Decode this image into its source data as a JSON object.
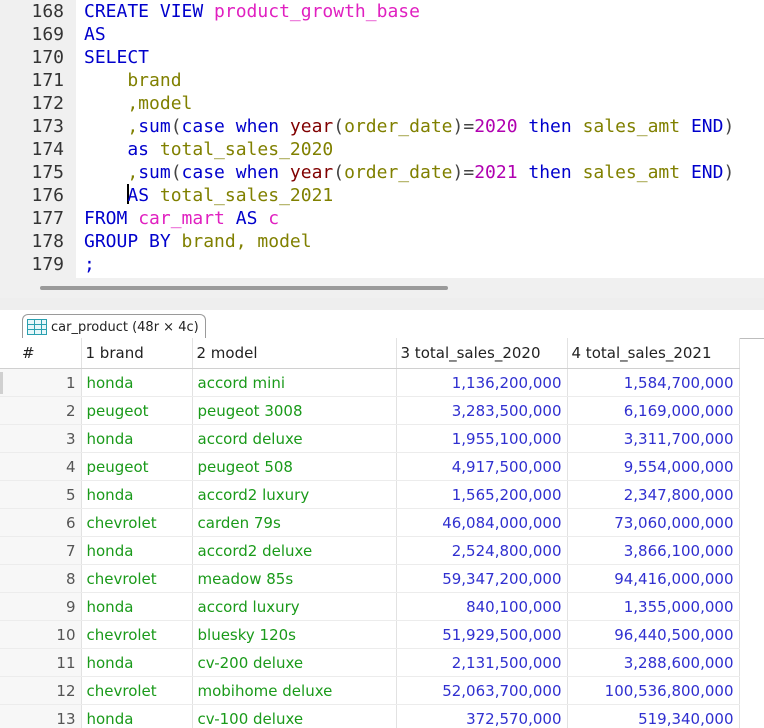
{
  "editor": {
    "lines": [
      {
        "n": "168",
        "tokens": [
          [
            "kw",
            "CREATE VIEW "
          ],
          [
            "id",
            "product_growth_base"
          ]
        ]
      },
      {
        "n": "169",
        "tokens": [
          [
            "kw",
            "AS"
          ]
        ]
      },
      {
        "n": "170",
        "tokens": [
          [
            "kw",
            "SELECT"
          ]
        ]
      },
      {
        "n": "171",
        "tokens": [
          [
            "col",
            "    brand"
          ]
        ]
      },
      {
        "n": "172",
        "tokens": [
          [
            "col",
            "    ,model"
          ]
        ]
      },
      {
        "n": "173",
        "tokens": [
          [
            "col",
            "    ,"
          ],
          [
            "kw",
            "sum"
          ],
          [
            "op",
            "("
          ],
          [
            "kw",
            "case when "
          ],
          [
            "fn",
            "year"
          ],
          [
            "op",
            "("
          ],
          [
            "col",
            "order_date"
          ],
          [
            "op",
            ")="
          ],
          [
            "num",
            "2020"
          ],
          [
            "kw",
            " then "
          ],
          [
            "col",
            "sales_amt "
          ],
          [
            "kw",
            "END"
          ],
          [
            "op",
            ")"
          ]
        ]
      },
      {
        "n": "174",
        "tokens": [
          [
            "kw",
            "    as "
          ],
          [
            "col",
            "total_sales_2020"
          ]
        ]
      },
      {
        "n": "175",
        "tokens": [
          [
            "col",
            "    ,"
          ],
          [
            "kw",
            "sum"
          ],
          [
            "op",
            "("
          ],
          [
            "kw",
            "case when "
          ],
          [
            "fn",
            "year"
          ],
          [
            "op",
            "("
          ],
          [
            "col",
            "order_date"
          ],
          [
            "op",
            ")="
          ],
          [
            "num",
            "2021"
          ],
          [
            "kw",
            " then "
          ],
          [
            "col",
            "sales_amt "
          ],
          [
            "kw",
            "END"
          ],
          [
            "op",
            ")"
          ]
        ]
      },
      {
        "n": "176",
        "tokens": [
          [
            "col",
            "    "
          ],
          [
            "caret",
            ""
          ],
          [
            "kw",
            "AS "
          ],
          [
            "col",
            "total_sales_2021"
          ]
        ]
      },
      {
        "n": "177",
        "tokens": [
          [
            "kw",
            "FROM "
          ],
          [
            "id",
            "car_mart "
          ],
          [
            "kw",
            "AS "
          ],
          [
            "id",
            "c"
          ]
        ]
      },
      {
        "n": "178",
        "tokens": [
          [
            "kw",
            "GROUP BY "
          ],
          [
            "col",
            "brand, model"
          ]
        ]
      },
      {
        "n": "179",
        "tokens": [
          [
            "kw",
            ";"
          ]
        ]
      }
    ]
  },
  "result": {
    "tab_label": "car_product (48r × 4c)",
    "tab_icon": "grid-icon",
    "columns": [
      "#",
      "1 brand",
      "2 model",
      "3 total_sales_2020",
      "4 total_sales_2021"
    ],
    "rows": [
      [
        "1",
        "honda",
        "accord mini",
        "1,136,200,000",
        "1,584,700,000"
      ],
      [
        "2",
        "peugeot",
        "peugeot 3008",
        "3,283,500,000",
        "6,169,000,000"
      ],
      [
        "3",
        "honda",
        "accord deluxe",
        "1,955,100,000",
        "3,311,700,000"
      ],
      [
        "4",
        "peugeot",
        "peugeot 508",
        "4,917,500,000",
        "9,554,000,000"
      ],
      [
        "5",
        "honda",
        "accord2 luxury",
        "1,565,200,000",
        "2,347,800,000"
      ],
      [
        "6",
        "chevrolet",
        "carden 79s",
        "46,084,000,000",
        "73,060,000,000"
      ],
      [
        "7",
        "honda",
        "accord2 deluxe",
        "2,524,800,000",
        "3,866,100,000"
      ],
      [
        "8",
        "chevrolet",
        "meadow 85s",
        "59,347,200,000",
        "94,416,000,000"
      ],
      [
        "9",
        "honda",
        "accord luxury",
        "840,100,000",
        "1,355,000,000"
      ],
      [
        "10",
        "chevrolet",
        "bluesky 120s",
        "51,929,500,000",
        "96,440,500,000"
      ],
      [
        "11",
        "honda",
        "cv-200 deluxe",
        "2,131,500,000",
        "3,288,600,000"
      ],
      [
        "12",
        "chevrolet",
        "mobihome deluxe",
        "52,063,700,000",
        "100,536,800,000"
      ],
      [
        "13",
        "honda",
        "cv-100 deluxe",
        "372,570,000",
        "519,340,000"
      ]
    ]
  },
  "colors": {
    "keyword": "#0000cc",
    "identifier": "#e020c0",
    "function": "#800000",
    "column": "#808000",
    "number": "#b000b0",
    "text_cell": "#1a9a1a",
    "numeric_cell": "#3030d0"
  }
}
